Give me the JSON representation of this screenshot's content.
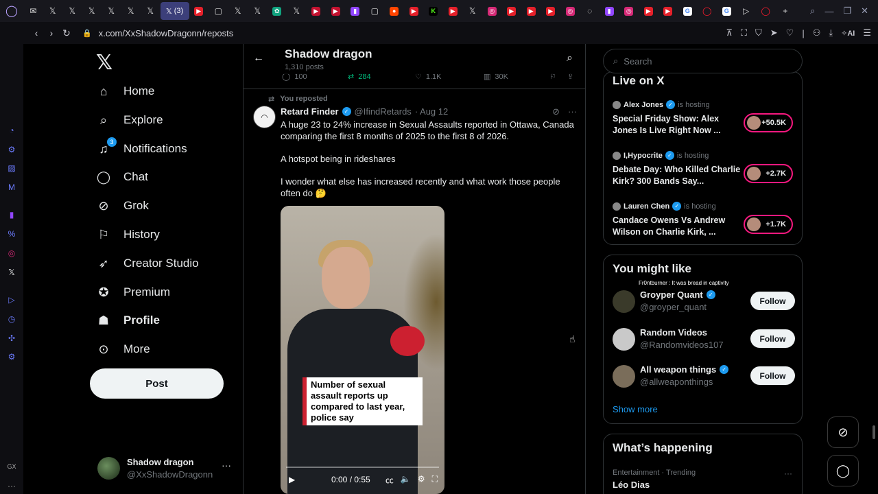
{
  "browser": {
    "url": "x.com/XxShadowDragonn/reposts",
    "active_tab_label": "(3)",
    "ai_label": "AI"
  },
  "nav": {
    "items": [
      {
        "label": "Home"
      },
      {
        "label": "Explore"
      },
      {
        "label": "Notifications",
        "badge": "3"
      },
      {
        "label": "Chat"
      },
      {
        "label": "Grok"
      },
      {
        "label": "History"
      },
      {
        "label": "Creator Studio"
      },
      {
        "label": "Premium"
      },
      {
        "label": "Profile"
      },
      {
        "label": "More"
      }
    ],
    "post_button": "Post",
    "account": {
      "name": "Shadow dragon",
      "handle": "@XxShadowDragonn"
    }
  },
  "header": {
    "title": "Shadow dragon",
    "subtitle": "1,310 posts"
  },
  "prev_actions": {
    "replies": "100",
    "reposts": "284",
    "likes": "1.1K",
    "views": "30K"
  },
  "tweet": {
    "reposted_label": "You reposted",
    "author": "Retard Finder",
    "handle": "@IfindRetards",
    "date": "· Aug 12",
    "para1": "A huge 23 to 24% increase in Sexual Assaults reported in Ottawa, Canada comparing the first 8 months of 2025 to the first 8 of 2026.",
    "para2": "A hotspot being in rideshares",
    "para3": "I wonder what else has increased recently and what work those people often do 🤔",
    "video": {
      "caption": "Number of sexual assault reports up compared to last year, police say",
      "time": "0:00 / 0:55"
    }
  },
  "right": {
    "search_placeholder": "Search",
    "live": {
      "title": "Live on X",
      "items": [
        {
          "host": "Alex Jones",
          "hosting": "is hosting",
          "title": "Special Friday Show: Alex Jones Is Live Right Now ...",
          "count": "+50.5K"
        },
        {
          "host": "I,Hypocrite",
          "hosting": "is hosting",
          "title": "Debate Day: Who Killed Charlie Kirk? 300 Bands Say...",
          "count": "+2.7K"
        },
        {
          "host": "Lauren Chen",
          "hosting": "is hosting",
          "title": "Candace Owens Vs Andrew Wilson on Charlie Kirk, ...",
          "count": "+1.7K"
        }
      ]
    },
    "wtf": {
      "title": "You might like",
      "overlay": "Fr0ntburner : It was bread in captivity",
      "items": [
        {
          "name": "Groyper Quant",
          "handle": "@groyper_quant",
          "follow": "Follow"
        },
        {
          "name": "Random Videos",
          "handle": "@Randomvideos107",
          "follow": "Follow"
        },
        {
          "name": "All weapon things",
          "handle": "@allweaponthings",
          "follow": "Follow"
        }
      ],
      "show_more": "Show more"
    },
    "happening": {
      "title": "What’s happening",
      "category": "Entertainment · Trending",
      "trend": "Léo Dias",
      "more": "···"
    }
  }
}
